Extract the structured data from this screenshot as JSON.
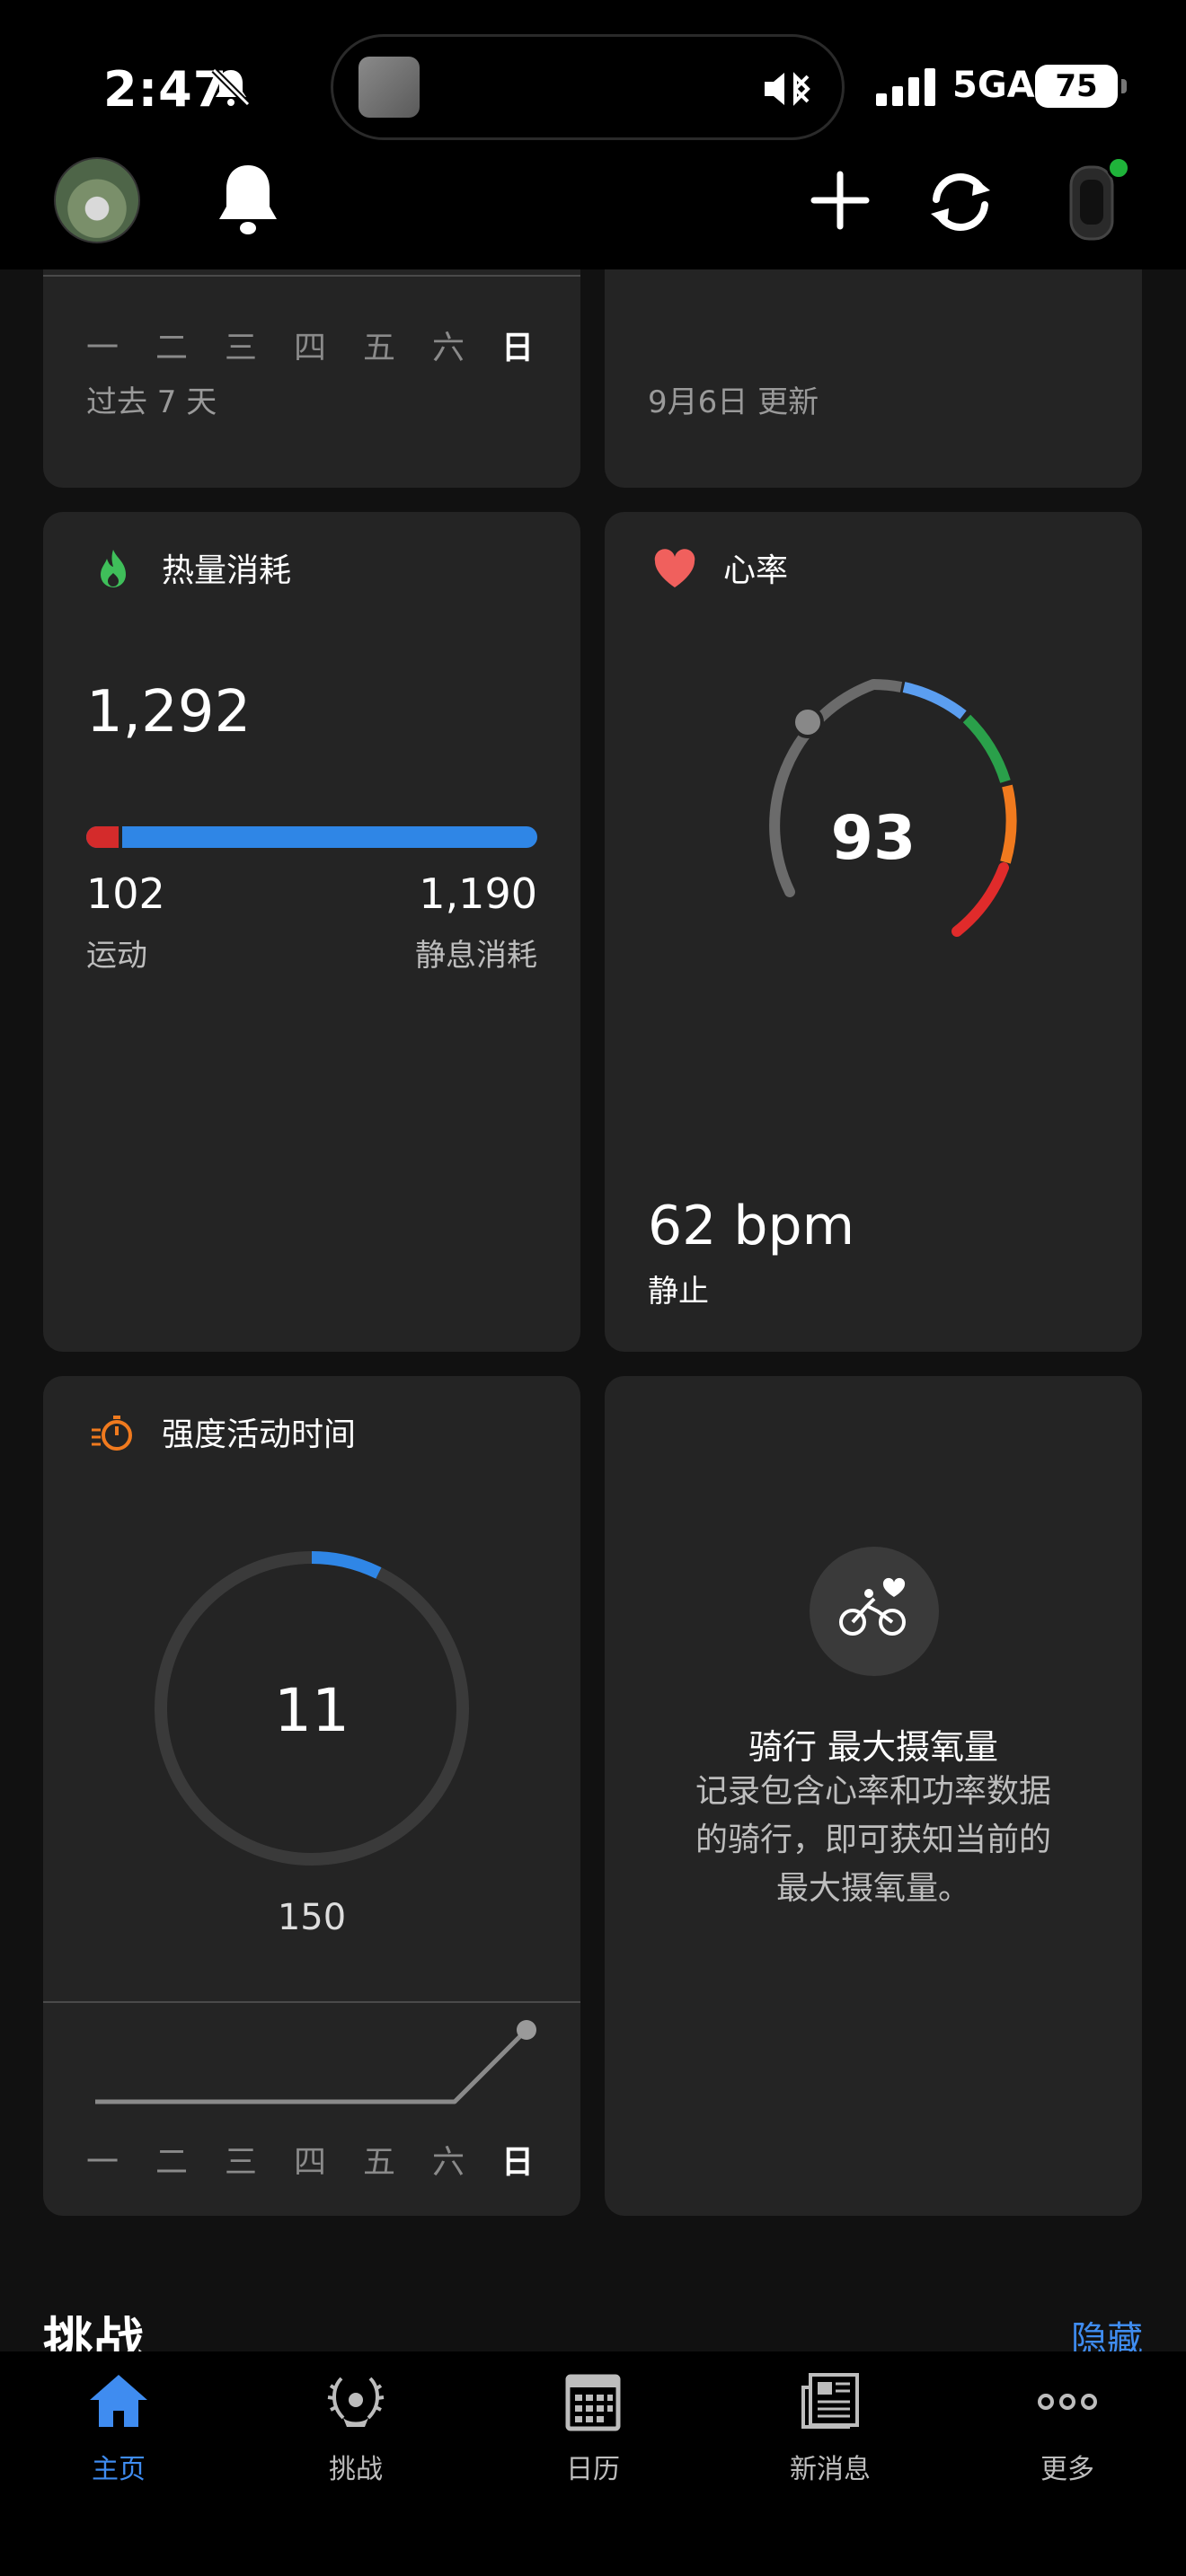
{
  "status_bar": {
    "time": "2:47",
    "network": "5GA",
    "battery": "75"
  },
  "cards": {
    "top_left": {
      "days": [
        "一",
        "二",
        "三",
        "四",
        "五",
        "六",
        "日"
      ],
      "active_day_index": 6,
      "caption": "过去 7 天"
    },
    "top_right": {
      "caption": "9月6日 更新"
    },
    "calories": {
      "title": "热量消耗",
      "total": "1,292",
      "active_value": "102",
      "active_label": "运动",
      "resting_value": "1,190",
      "resting_label": "静息消耗",
      "active_fraction": 0.079,
      "colors": {
        "active": "#d42b2b",
        "resting": "#2f86e6"
      }
    },
    "heart_rate": {
      "title": "心率",
      "current": "93",
      "resting_value": "62 bpm",
      "resting_label": "静止",
      "zone_colors": [
        "#5b9ef0",
        "#2aa04a",
        "#f07a1e",
        "#e02b2b"
      ]
    },
    "intensity": {
      "title": "强度活动时间",
      "value": "11",
      "goal": "150",
      "progress_fraction": 0.073,
      "days": [
        "一",
        "二",
        "三",
        "四",
        "五",
        "六",
        "日"
      ],
      "active_day_index": 6,
      "accent": "#2f86e6"
    },
    "vo2max": {
      "title": "骑行 最大摄氧量",
      "description_lines": [
        "记录包含心率和功率数据",
        "的骑行，即可获知当前的",
        "最大摄氧量。"
      ]
    }
  },
  "section": {
    "title": "挑战",
    "action": "隐藏"
  },
  "tabbar": {
    "items": [
      {
        "label": "主页",
        "icon": "home-icon",
        "active": true
      },
      {
        "label": "挑战",
        "icon": "laurel-icon",
        "active": false
      },
      {
        "label": "日历",
        "icon": "calendar-icon",
        "active": false
      },
      {
        "label": "新消息",
        "icon": "news-icon",
        "active": false
      },
      {
        "label": "更多",
        "icon": "more-icon",
        "active": false
      }
    ],
    "active_color": "#3f8cf0"
  }
}
